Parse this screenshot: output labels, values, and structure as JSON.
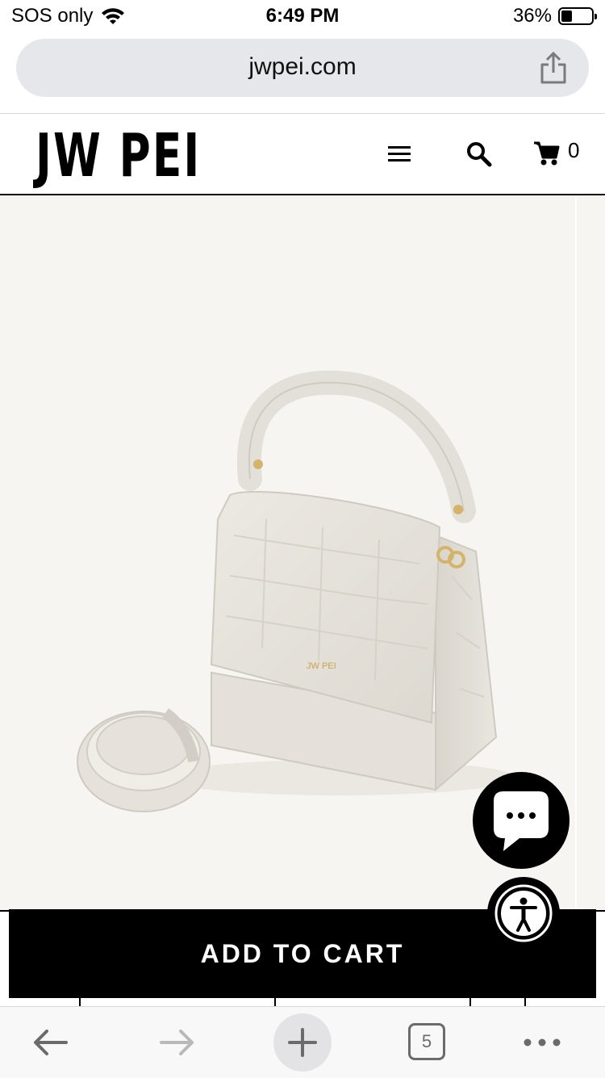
{
  "status_bar": {
    "carrier": "SOS only",
    "time": "6:49 PM",
    "battery_percent": "36%",
    "battery_level": 0.36
  },
  "browser": {
    "url": "jwpei.com",
    "tab_count": "5"
  },
  "header": {
    "logo": "JW PEI",
    "cart_count": "0"
  },
  "product": {
    "add_to_cart_label": "ADD TO CART",
    "bag_logo_text": "JW PEI",
    "accent": "#f7f5f2"
  },
  "icons": {
    "menu": "hamburger-icon",
    "search": "search-icon",
    "cart": "cart-icon",
    "share": "share-icon",
    "chat": "chat-bubble-icon",
    "accessibility": "accessibility-icon",
    "back": "arrow-left-icon",
    "forward": "arrow-right-icon",
    "new_tab": "plus-icon",
    "more": "ellipsis-icon"
  }
}
